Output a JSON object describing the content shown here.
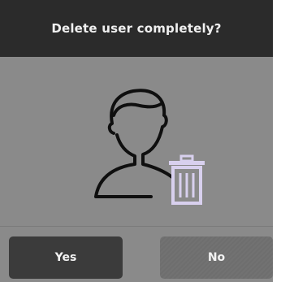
{
  "dialog": {
    "title": "Delete user completely?",
    "icons": {
      "user": "user-silhouette-icon",
      "trash": "trash-can-icon"
    },
    "buttons": {
      "yes_label": "Yes",
      "no_label": "No"
    },
    "colors": {
      "header_bg": "#2b2b2b",
      "body_bg": "#8a8a8a",
      "yes_button_bg": "#3b3b3b",
      "no_button_bg": "#6e6e6e",
      "trash_icon": "#d8d0ee",
      "button_text": "#f2f2f2"
    }
  }
}
